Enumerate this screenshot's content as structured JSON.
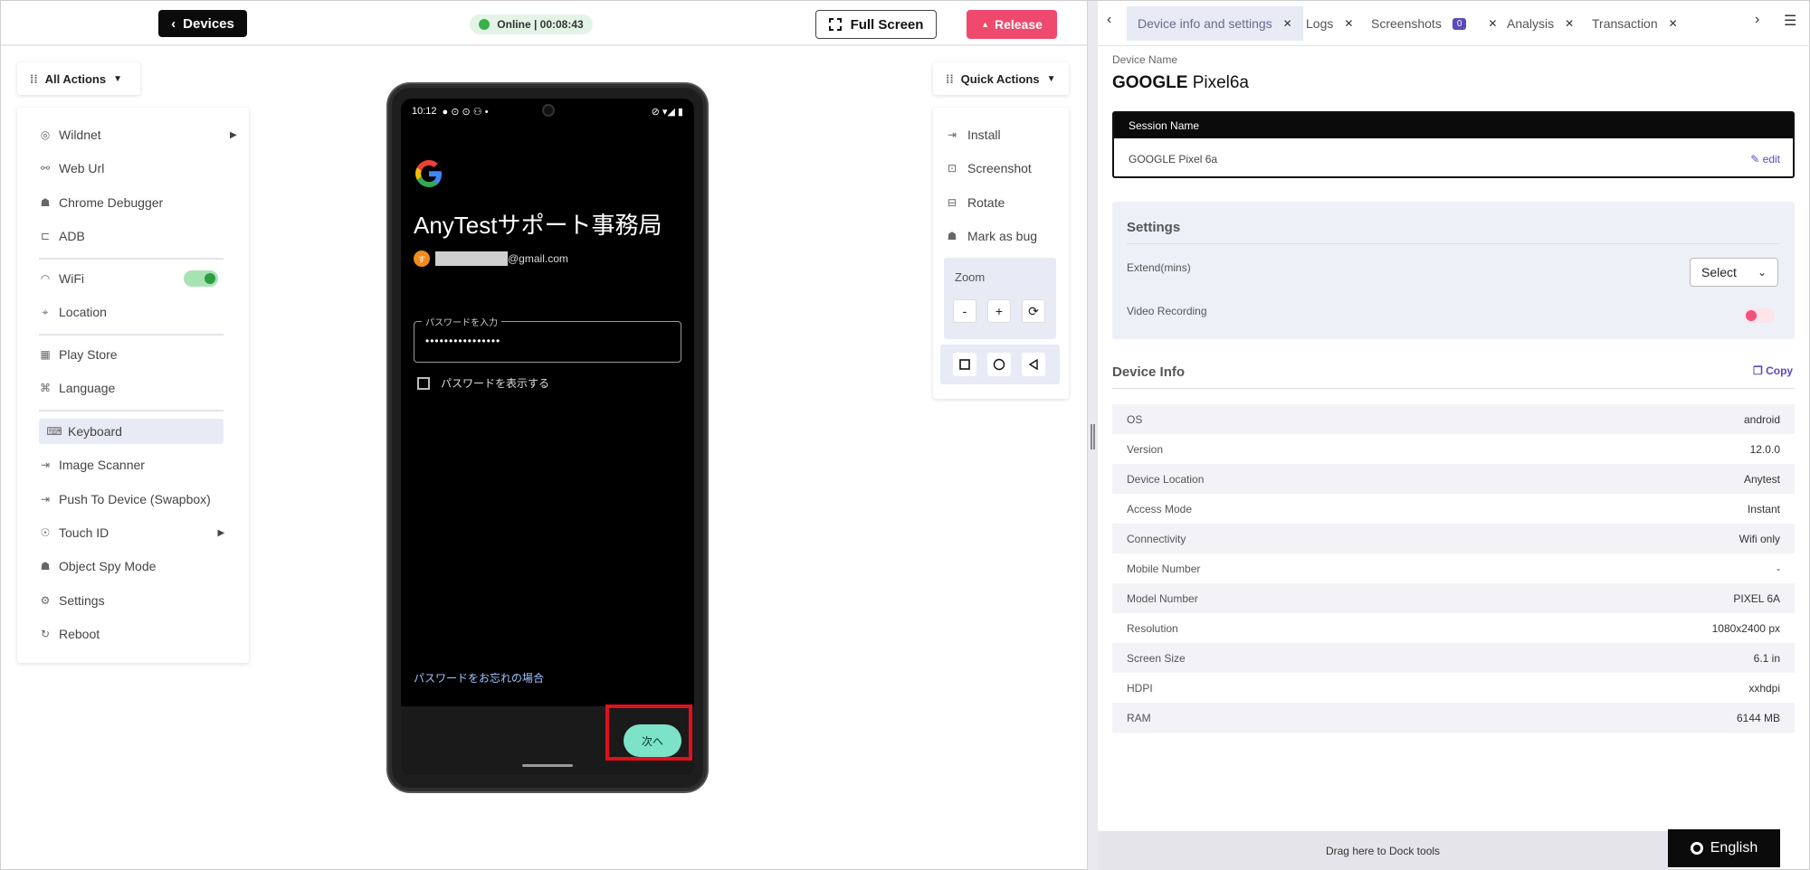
{
  "topbar": {
    "devices_label": "Devices",
    "online_status": "Online | 00:08:43",
    "fullscreen_label": "Full Screen",
    "release_label": "Release"
  },
  "left": {
    "all_actions_label": "All Actions",
    "items": [
      {
        "label": "Wildnet",
        "icon": "wifi-tethering-icon",
        "arrow": "▶"
      },
      {
        "label": "Web Url",
        "icon": "link-icon"
      },
      {
        "label": "Chrome Debugger",
        "icon": "bug-icon"
      },
      {
        "label": "ADB",
        "icon": "adb-icon"
      },
      {
        "label": "WiFi",
        "icon": "wifi-icon"
      },
      {
        "label": "Location",
        "icon": "location-pin-icon"
      },
      {
        "label": "Play Store",
        "icon": "apps-icon"
      },
      {
        "label": "Language",
        "icon": "translate-icon"
      },
      {
        "label": "Keyboard",
        "icon": "keyboard-icon"
      },
      {
        "label": "Image Scanner",
        "icon": "scanner-icon"
      },
      {
        "label": "Push To Device (Swapbox)",
        "icon": "push-icon"
      },
      {
        "label": "Touch ID",
        "icon": "fingerprint-icon",
        "arrow": "▶"
      },
      {
        "label": "Object Spy Mode",
        "icon": "spy-icon"
      },
      {
        "label": "Settings",
        "icon": "gear-icon"
      },
      {
        "label": "Reboot",
        "icon": "reboot-icon"
      }
    ]
  },
  "phone": {
    "time": "10:12",
    "title": "AnyTestサポート事務局",
    "avatar_letter": "す",
    "email_suffix": "@gmail.com",
    "pw_label": "パスワードを入力",
    "pw_value": "••••••••••••••••",
    "show_pw": "パスワードを表示する",
    "forgot": "パスワードをお忘れの場合",
    "next": "次へ"
  },
  "quick": {
    "label": "Quick Actions",
    "items": [
      "Install",
      "Screenshot",
      "Rotate",
      "Mark as bug"
    ],
    "zoom_label": "Zoom",
    "zoom_minus": "-",
    "zoom_plus": "+"
  },
  "tabs": {
    "items": [
      "Device info and settings",
      "Logs",
      "Screenshots",
      "Analysis",
      "Transaction"
    ],
    "screenshot_count": "0"
  },
  "device": {
    "name_label": "Device Name",
    "brand": "GOOGLE",
    "model": "Pixel6a",
    "session_head": "Session Name",
    "session_value": "GOOGLE Pixel 6a",
    "edit_label": "edit"
  },
  "settings": {
    "title": "Settings",
    "extend_label": "Extend(mins)",
    "select_value": "Select",
    "video_label": "Video Recording"
  },
  "devinfo": {
    "title": "Device Info",
    "copy_label": "Copy",
    "rows": [
      {
        "k": "OS",
        "v": "android"
      },
      {
        "k": "Version",
        "v": "12.0.0"
      },
      {
        "k": "Device Location",
        "v": "Anytest"
      },
      {
        "k": "Access Mode",
        "v": "Instant"
      },
      {
        "k": "Connectivity",
        "v": "Wifi only"
      },
      {
        "k": "Mobile Number",
        "v": "-"
      },
      {
        "k": "Model Number",
        "v": "PIXEL 6A"
      },
      {
        "k": "Resolution",
        "v": "1080x2400 px"
      },
      {
        "k": "Screen Size",
        "v": "6.1 in"
      },
      {
        "k": "HDPI",
        "v": "xxhdpi"
      },
      {
        "k": "RAM",
        "v": "6144 MB"
      }
    ]
  },
  "footer": {
    "dock_text": "Drag here to Dock tools",
    "language": "English"
  },
  "colors": {
    "accent": "#5a4bbd",
    "release": "#ef4a6e",
    "online": "#36b24a",
    "next_button": "#7de3c8",
    "highlight_box": "#e0101e"
  }
}
